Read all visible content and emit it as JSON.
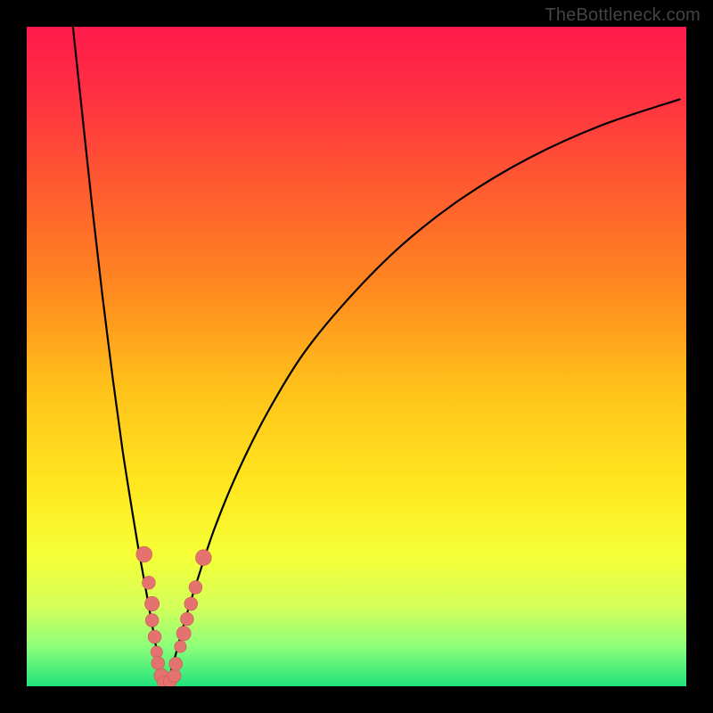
{
  "branding": {
    "label": "TheBottleneck.com"
  },
  "colors": {
    "frame": "#000000",
    "curve": "#000000",
    "marker_fill": "#e4736f",
    "marker_stroke": "#c85a56",
    "gradient_stops": [
      {
        "offset": 0.0,
        "color": "#ff1a4b"
      },
      {
        "offset": 0.1,
        "color": "#ff2f43"
      },
      {
        "offset": 0.25,
        "color": "#ff5d2f"
      },
      {
        "offset": 0.4,
        "color": "#ff8a1f"
      },
      {
        "offset": 0.55,
        "color": "#ffc21a"
      },
      {
        "offset": 0.7,
        "color": "#ffe81f"
      },
      {
        "offset": 0.8,
        "color": "#f6ff36"
      },
      {
        "offset": 0.88,
        "color": "#d4ff5a"
      },
      {
        "offset": 0.94,
        "color": "#8dff7a"
      },
      {
        "offset": 1.0,
        "color": "#20e37a"
      }
    ]
  },
  "chart_data": {
    "type": "line",
    "title": "",
    "xlabel": "",
    "ylabel": "",
    "xlim": [
      0,
      100
    ],
    "ylim": [
      0,
      100
    ],
    "note": "Values read off the image in plot-area percent coordinates (x%, y%=0 at top). The curve is two branches of a bottleneck notch. Markers are small pink dots clustered near the notch bottom.",
    "series": [
      {
        "name": "left-branch",
        "x": [
          7.0,
          8.5,
          10.0,
          11.5,
          13.0,
          14.5,
          16.0,
          17.0,
          18.0,
          18.8,
          19.4,
          19.8,
          20.1,
          20.6
        ],
        "y": [
          0.0,
          14.0,
          28.0,
          41.0,
          53.0,
          64.0,
          73.5,
          79.5,
          85.0,
          89.5,
          92.8,
          95.3,
          97.2,
          99.3
        ]
      },
      {
        "name": "right-branch",
        "x": [
          21.4,
          22.5,
          24.0,
          26.0,
          28.5,
          32.0,
          36.5,
          42.0,
          49.0,
          57.0,
          66.0,
          76.0,
          87.0,
          99.0
        ],
        "y": [
          99.3,
          95.5,
          90.0,
          83.5,
          76.0,
          67.5,
          58.5,
          49.5,
          41.0,
          33.0,
          26.0,
          20.0,
          15.0,
          11.0
        ]
      }
    ],
    "markers": [
      {
        "x": 17.8,
        "y": 80.0,
        "r": 1.2
      },
      {
        "x": 18.5,
        "y": 84.3,
        "r": 1.0
      },
      {
        "x": 19.0,
        "y": 87.5,
        "r": 1.1
      },
      {
        "x": 19.0,
        "y": 90.0,
        "r": 1.0
      },
      {
        "x": 19.4,
        "y": 92.5,
        "r": 1.0
      },
      {
        "x": 19.7,
        "y": 94.8,
        "r": 0.9
      },
      {
        "x": 19.9,
        "y": 96.5,
        "r": 1.0
      },
      {
        "x": 20.4,
        "y": 98.4,
        "r": 1.1
      },
      {
        "x": 20.8,
        "y": 99.4,
        "r": 1.0
      },
      {
        "x": 21.7,
        "y": 99.3,
        "r": 1.0
      },
      {
        "x": 22.4,
        "y": 98.4,
        "r": 1.0
      },
      {
        "x": 22.6,
        "y": 96.6,
        "r": 1.0
      },
      {
        "x": 23.3,
        "y": 94.0,
        "r": 0.9
      },
      {
        "x": 23.8,
        "y": 92.0,
        "r": 1.1
      },
      {
        "x": 24.3,
        "y": 89.8,
        "r": 1.0
      },
      {
        "x": 24.9,
        "y": 87.5,
        "r": 1.0
      },
      {
        "x": 25.6,
        "y": 85.0,
        "r": 1.0
      },
      {
        "x": 26.8,
        "y": 80.5,
        "r": 1.2
      }
    ]
  }
}
